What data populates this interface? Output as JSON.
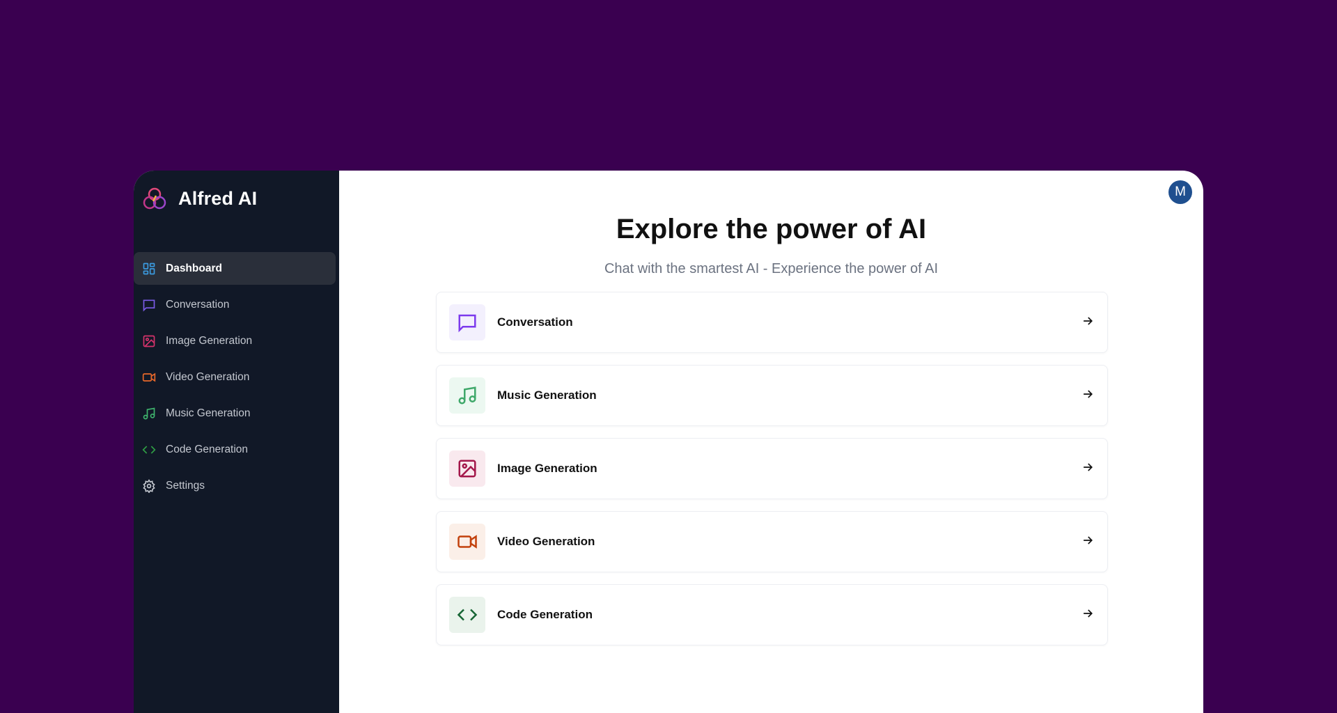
{
  "app": {
    "name": "Alfred AI",
    "avatar_initial": "M"
  },
  "sidebar": {
    "items": [
      {
        "label": "Dashboard",
        "icon": "dashboard-icon",
        "color": "#3b9be0"
      },
      {
        "label": "Conversation",
        "icon": "message-square-icon",
        "color": "#7c5ce8"
      },
      {
        "label": "Image Generation",
        "icon": "image-icon",
        "color": "#d6336c"
      },
      {
        "label": "Video Generation",
        "icon": "video-icon",
        "color": "#e8682a"
      },
      {
        "label": "Music Generation",
        "icon": "music-icon",
        "color": "#3fb56e"
      },
      {
        "label": "Code Generation",
        "icon": "code-icon",
        "color": "#2f9e44"
      },
      {
        "label": "Settings",
        "icon": "settings-icon",
        "color": "#c4c8d0"
      }
    ]
  },
  "main": {
    "title": "Explore the power of AI",
    "subtitle": "Chat with the smartest AI - Experience the power of AI",
    "cards": [
      {
        "label": "Conversation",
        "icon": "message-square-icon",
        "color": "#7c3aed",
        "bg": "#f3f0fd"
      },
      {
        "label": "Music Generation",
        "icon": "music-icon",
        "color": "#3fa86a",
        "bg": "#ecf8f1"
      },
      {
        "label": "Image Generation",
        "icon": "image-icon",
        "color": "#a3174a",
        "bg": "#f9e9ee"
      },
      {
        "label": "Video Generation",
        "icon": "video-icon",
        "color": "#c2410c",
        "bg": "#fbefe8"
      },
      {
        "label": "Code Generation",
        "icon": "code-icon",
        "color": "#166534",
        "bg": "#eaf3ec"
      }
    ]
  }
}
